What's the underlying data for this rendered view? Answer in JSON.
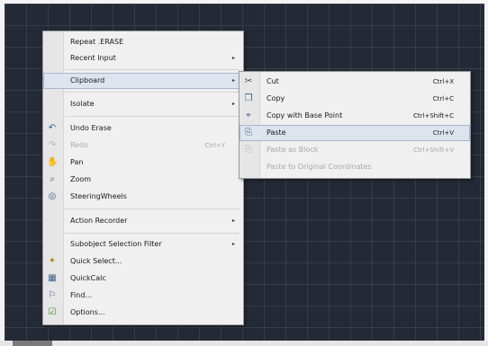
{
  "context_menu": {
    "items": [
      {
        "label": "Repeat .ERASE"
      },
      {
        "label": "Recent Input"
      },
      {
        "label": "Clipboard"
      },
      {
        "label": "Isolate"
      },
      {
        "label": "Undo Erase"
      },
      {
        "label": "Redo",
        "shortcut": "Ctrl+Y"
      },
      {
        "label": "Pan"
      },
      {
        "label": "Zoom"
      },
      {
        "label": "SteeringWheels"
      },
      {
        "label": "Action Recorder"
      },
      {
        "label": "Subobject Selection Filter"
      },
      {
        "label": "Quick Select..."
      },
      {
        "label": "QuickCalc"
      },
      {
        "label": "Find..."
      },
      {
        "label": "Options..."
      }
    ]
  },
  "clipboard_menu": {
    "items": [
      {
        "label": "Cut",
        "shortcut": "Ctrl+X"
      },
      {
        "label": "Copy",
        "shortcut": "Ctrl+C"
      },
      {
        "label": "Copy with Base Point",
        "shortcut": "Ctrl+Shift+C"
      },
      {
        "label": "Paste",
        "shortcut": "Ctrl+V"
      },
      {
        "label": "Paste as Block",
        "shortcut": "Ctrl+Shift+V"
      },
      {
        "label": "Paste to Original Coordinates"
      }
    ]
  },
  "icons": {
    "submenu_arrow": "▸",
    "cut": "✂",
    "copy": "❐",
    "copy_base": "⌖",
    "paste": "⎘",
    "paste_block": "⎘",
    "undo": "↶",
    "redo": "↷",
    "pan": "✋",
    "zoom": "⌕",
    "wheel": "◎",
    "quick_select": "✦",
    "quickcalc": "▦",
    "find": "⚐",
    "options": "☑"
  },
  "colors": {
    "canvas": "#232935",
    "menu_bg": "#f0f0f0",
    "highlight": "#dde4ee"
  }
}
